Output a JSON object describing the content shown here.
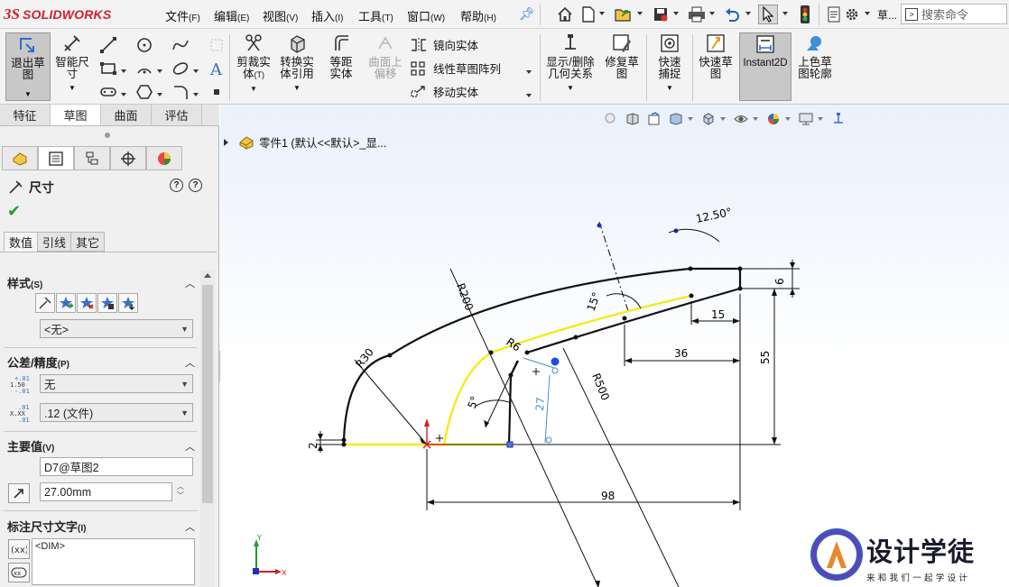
{
  "brand": {
    "ds": "3S",
    "name": "SOLIDWORKS",
    "color": "#d1202a"
  },
  "menu": [
    {
      "label": "文件",
      "key": "(F)"
    },
    {
      "label": "编辑",
      "key": "(E)"
    },
    {
      "label": "视图",
      "key": "(V)"
    },
    {
      "label": "插入",
      "key": "(I)"
    },
    {
      "label": "工具",
      "key": "(T)"
    },
    {
      "label": "窗口",
      "key": "(W)"
    },
    {
      "label": "帮助",
      "key": "(H)"
    }
  ],
  "quick_access": {
    "overflow_label": "草..."
  },
  "search": {
    "placeholder": "搜索命令"
  },
  "command_manager": {
    "exit_sketch": "退出草图",
    "smart_dimension": "智能尺寸",
    "trim_entities": "剪裁实体",
    "trim_key": "(T)",
    "convert_entities": "转换实体引用",
    "offset_entities": "等距实体",
    "surface_offset": "曲面上偏移",
    "mirror_entities": "镜向实体",
    "linear_pattern": "线性草图阵列",
    "move_entities": "移动实体",
    "show_delete_relations": "显示/删除几何关系",
    "repair_sketch": "修复草图",
    "quick_snaps": "快速捕捉",
    "rapid_sketch": "快速草图",
    "instant2d": "Instant2D",
    "shaded_contours": "上色草图轮廓"
  },
  "tabs": [
    "特征",
    "草图",
    "曲面",
    "评估"
  ],
  "active_tab": 1,
  "property_manager": {
    "title": "尺寸",
    "subtabs": [
      "数值",
      "引线",
      "其它"
    ],
    "style_section": {
      "title": "样式",
      "key": "(S)",
      "dropdown": "<无>"
    },
    "tolerance_section": {
      "title": "公差/精度",
      "key": "(P)",
      "tolerance_type": "无",
      "precision": ".12 (文件)",
      "tol_icon_lines": [
        "+.01",
        "1.50",
        "-.01"
      ],
      "prec_icon_lines": [
        ".01",
        "X.XX",
        ".01"
      ]
    },
    "primary_value": {
      "title": "主要值",
      "key": "(V)",
      "name": "D7@草图2",
      "value": "27.00mm"
    },
    "dim_text": {
      "title": "标注尺寸文字",
      "key": "(I)",
      "text": "<DIM>"
    }
  },
  "graphics": {
    "tree_label": "零件1 (默认<<默认>_显...",
    "dimensions": {
      "angle_top": "12.50°",
      "r200": "R200",
      "r30": "R30",
      "r6": "R6",
      "r500": "R500",
      "angle_15": "15°",
      "angle_5": "5°",
      "d27": "27",
      "d6": "6",
      "d15": "15",
      "d36": "36",
      "d55": "55",
      "d2": "2",
      "d98": "98"
    }
  },
  "watermark": {
    "title": "设计学徒",
    "subtitle": "来和我们一起学设计"
  },
  "colors": {
    "selected_geometry": "#f5ea1a",
    "driven_dimension": "#4a90c8",
    "sketch_point": "#1f2fc4",
    "check_green": "#1e9d2d"
  }
}
